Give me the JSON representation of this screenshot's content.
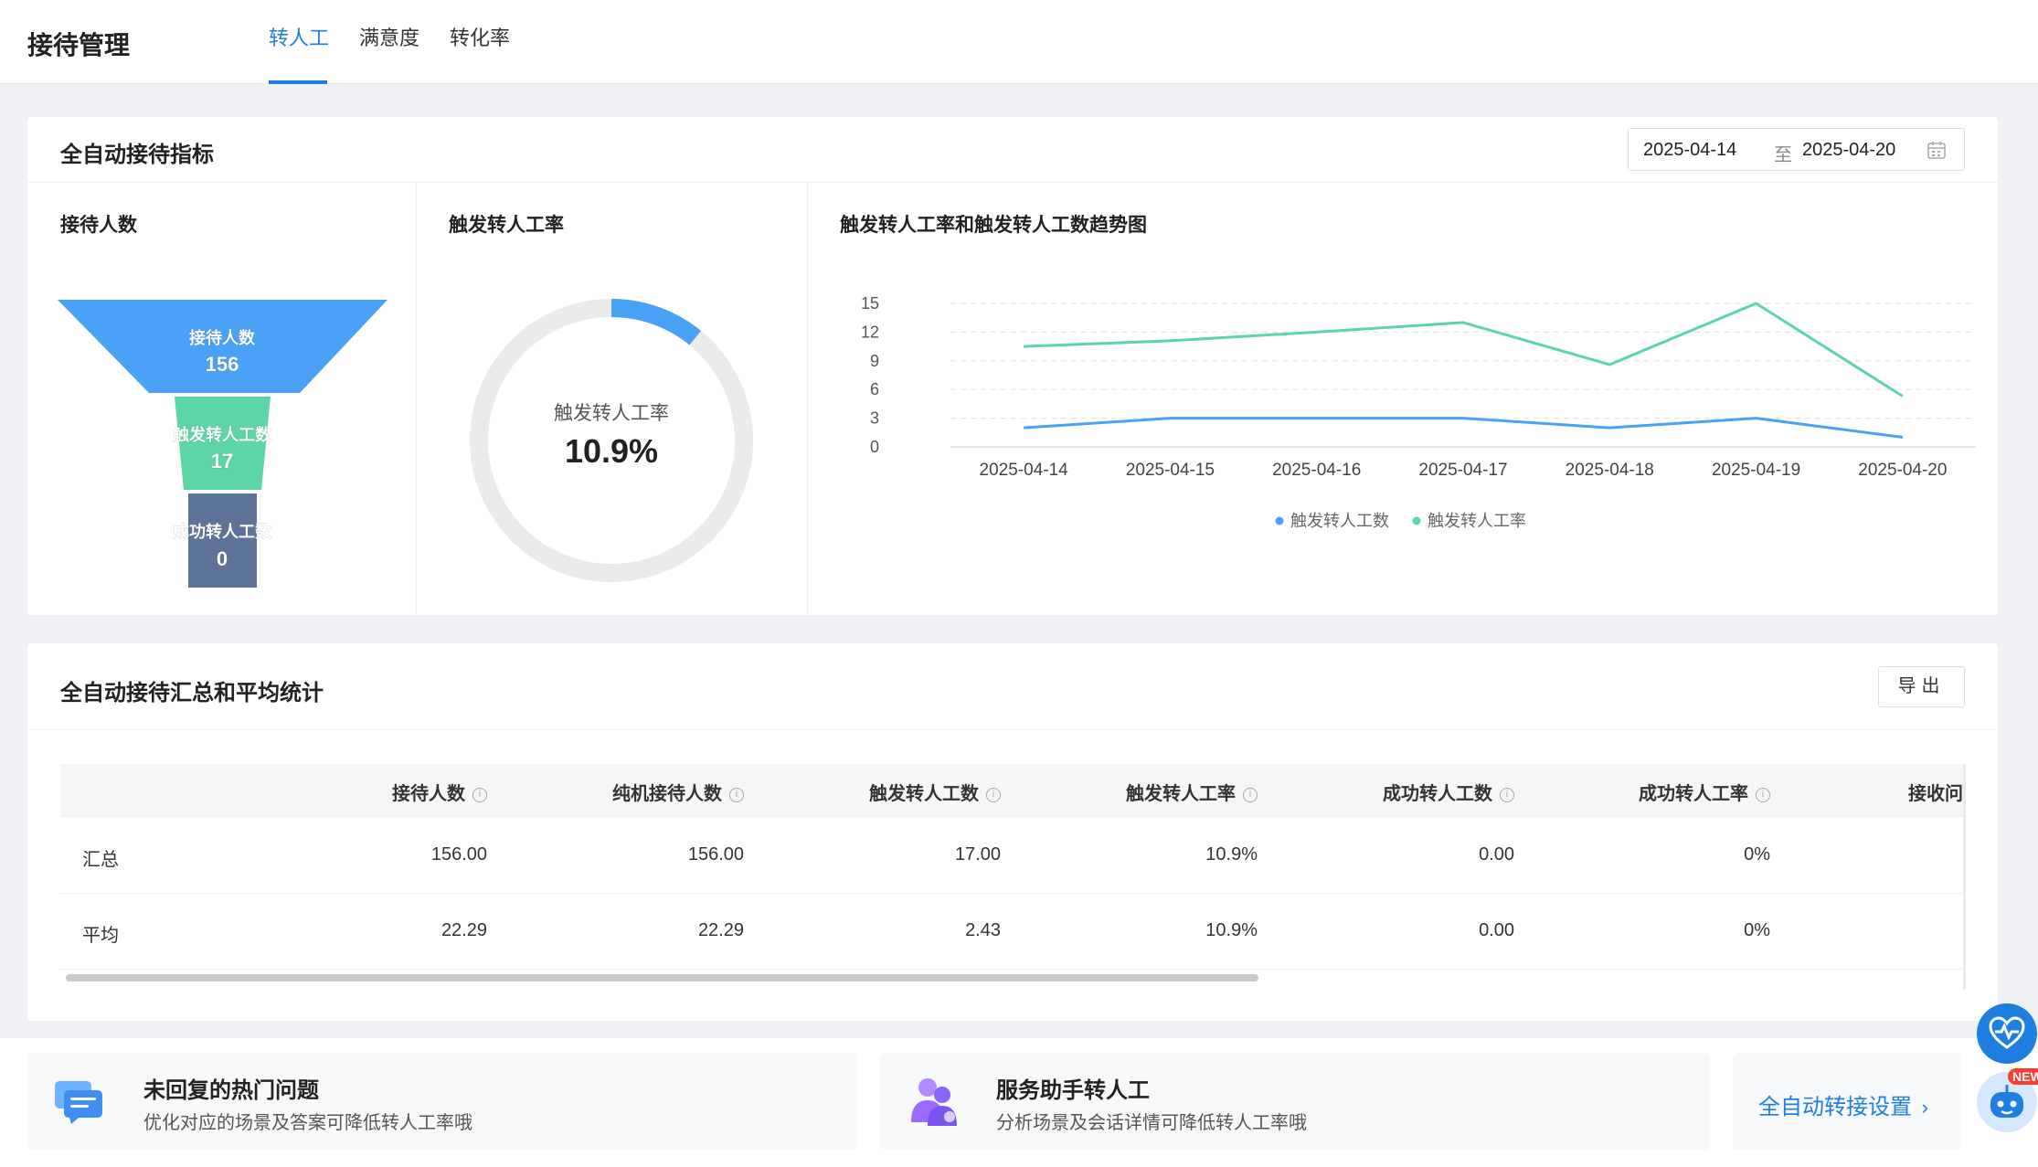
{
  "header": {
    "title": "接待管理",
    "tabs": [
      {
        "label": "转人工",
        "active": true
      },
      {
        "label": "满意度",
        "active": false
      },
      {
        "label": "转化率",
        "active": false
      }
    ]
  },
  "metrics_card": {
    "title": "全自动接待指标",
    "date_start": "2025-04-14",
    "date_sep": "至",
    "date_end": "2025-04-20"
  },
  "funnel": {
    "title": "接待人数",
    "stages": [
      {
        "label": "接待人数",
        "value": "156",
        "color": "#4aa2f7"
      },
      {
        "label": "触发转人工数",
        "value": "17",
        "color": "#5cd6a6"
      },
      {
        "label": "成功转人工数",
        "value": "0",
        "color": "#5e7398"
      }
    ]
  },
  "gauge": {
    "title": "触发转人工率",
    "center_label": "触发转人工率",
    "center_value": "10.9%",
    "fraction": 0.109,
    "color": "#4aa2f7",
    "track_color": "#ebebeb"
  },
  "chart_data": {
    "type": "line",
    "title": "触发转人工率和触发转人工数趋势图",
    "x": [
      "2025-04-14",
      "2025-04-15",
      "2025-04-16",
      "2025-04-17",
      "2025-04-18",
      "2025-04-19",
      "2025-04-20"
    ],
    "ylim": [
      0,
      15
    ],
    "yticks": [
      0,
      3,
      6,
      9,
      12,
      15
    ],
    "grid": true,
    "legend_position": "bottom",
    "series": [
      {
        "name": "触发转人工数",
        "color": "#4aa2f7",
        "values": [
          2,
          3,
          3,
          3,
          2,
          3,
          1
        ]
      },
      {
        "name": "触发转人工率",
        "color": "#5cd6a6",
        "values": [
          10.5,
          11.1,
          12.0,
          13.0,
          8.6,
          15.0,
          5.3
        ]
      }
    ]
  },
  "summary_card": {
    "title": "全自动接待汇总和平均统计",
    "export_label": "导出",
    "columns": [
      "接待人数",
      "纯机接待人数",
      "触发转人工数",
      "触发转人工率",
      "成功转人工数",
      "成功转人工率",
      "接收问"
    ],
    "rows": [
      {
        "label": "汇总",
        "cells": [
          "156.00",
          "156.00",
          "17.00",
          "10.9%",
          "0.00",
          "0%"
        ]
      },
      {
        "label": "平均",
        "cells": [
          "22.29",
          "22.29",
          "2.43",
          "10.9%",
          "0.00",
          "0%"
        ]
      }
    ]
  },
  "promos": [
    {
      "title": "未回复的热门问题",
      "desc": "优化对应的场景及答案可降低转人工率哦"
    },
    {
      "title": "服务助手转人工",
      "desc": "分析场景及会话详情可降低转人工率哦"
    }
  ],
  "auto_transfer_link": "全自动转接设置",
  "new_badge": "NEW"
}
